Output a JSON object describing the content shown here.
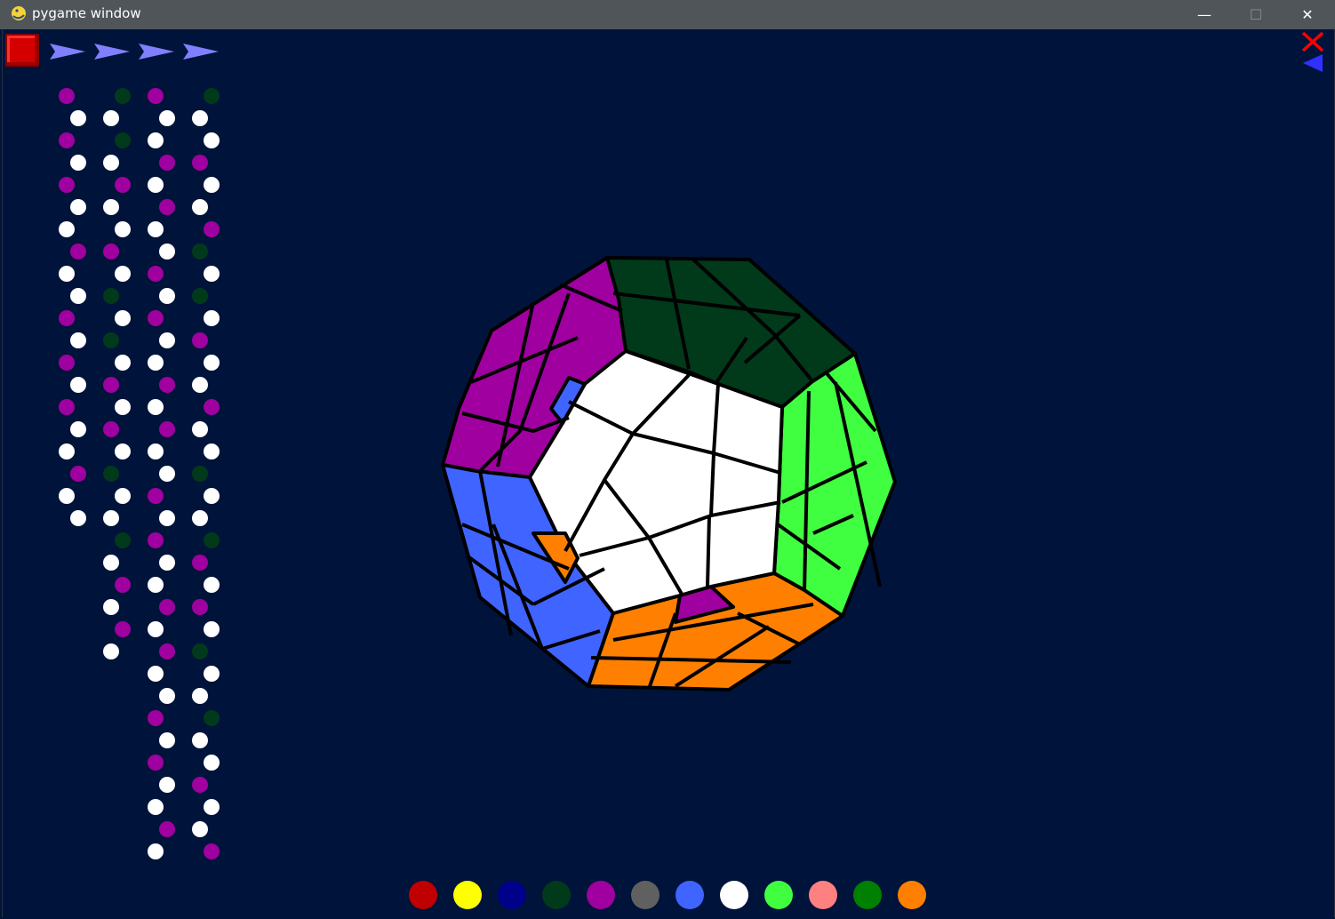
{
  "window": {
    "title": "pygame window",
    "minimize_glyph": "—",
    "maximize_glyph": "☐",
    "close_glyph": "✕"
  },
  "toolbar": {
    "stop_icon": "red-square-stop",
    "play_icon": "blue-arrow-right",
    "play_buttons": 4,
    "close_icon": "red-x",
    "back_icon": "blue-arrow-left"
  },
  "dot_colors": {
    "w": "#ffffff",
    "p": "#a000a0",
    "g": "#003a1a"
  },
  "move_columns": [
    [
      "p",
      "w",
      "p",
      "w",
      "p",
      "w",
      "w",
      "p",
      "w",
      "w",
      "p",
      "w",
      "p",
      "w",
      "p",
      "w",
      "w",
      "p",
      "w",
      "w"
    ],
    [
      "g",
      "w",
      "g",
      "w",
      "p",
      "w",
      "w",
      "p",
      "w",
      "g",
      "w",
      "g",
      "w",
      "p",
      "w",
      "p",
      "w",
      "g",
      "w",
      "w",
      "g",
      "w",
      "p",
      "w",
      "p",
      "w"
    ],
    [
      "p",
      "w",
      "w",
      "p",
      "w",
      "p",
      "w",
      "w",
      "p",
      "w",
      "p",
      "w",
      "w",
      "p",
      "w",
      "p",
      "w",
      "w",
      "p",
      "w",
      "p",
      "w",
      "w",
      "p",
      "w",
      "p",
      "w",
      "w",
      "p",
      "w",
      "p",
      "w",
      "w",
      "p",
      "w"
    ],
    [
      "g",
      "w",
      "w",
      "p",
      "w",
      "w",
      "p",
      "g",
      "w",
      "g",
      "w",
      "p",
      "w",
      "w",
      "p",
      "w",
      "w",
      "g",
      "w",
      "w",
      "g",
      "p",
      "w",
      "p",
      "w",
      "g",
      "w",
      "w",
      "g",
      "w",
      "w",
      "p",
      "w",
      "w",
      "p"
    ]
  ],
  "megaminx": {
    "outline_color": "#000000",
    "visible_faces": [
      "white",
      "dark-green",
      "green",
      "orange",
      "blue",
      "purple"
    ]
  },
  "palette": [
    {
      "name": "red",
      "color": "#c00000"
    },
    {
      "name": "yellow",
      "color": "#ffff00"
    },
    {
      "name": "navy",
      "color": "#00008a"
    },
    {
      "name": "dark-green",
      "color": "#003a1a"
    },
    {
      "name": "purple",
      "color": "#a000a0"
    },
    {
      "name": "gray",
      "color": "#606060"
    },
    {
      "name": "blue",
      "color": "#4064ff"
    },
    {
      "name": "white",
      "color": "#ffffff"
    },
    {
      "name": "light-green",
      "color": "#40ff40"
    },
    {
      "name": "pink",
      "color": "#ff8080"
    },
    {
      "name": "green",
      "color": "#008000"
    },
    {
      "name": "orange",
      "color": "#ff8000"
    }
  ]
}
